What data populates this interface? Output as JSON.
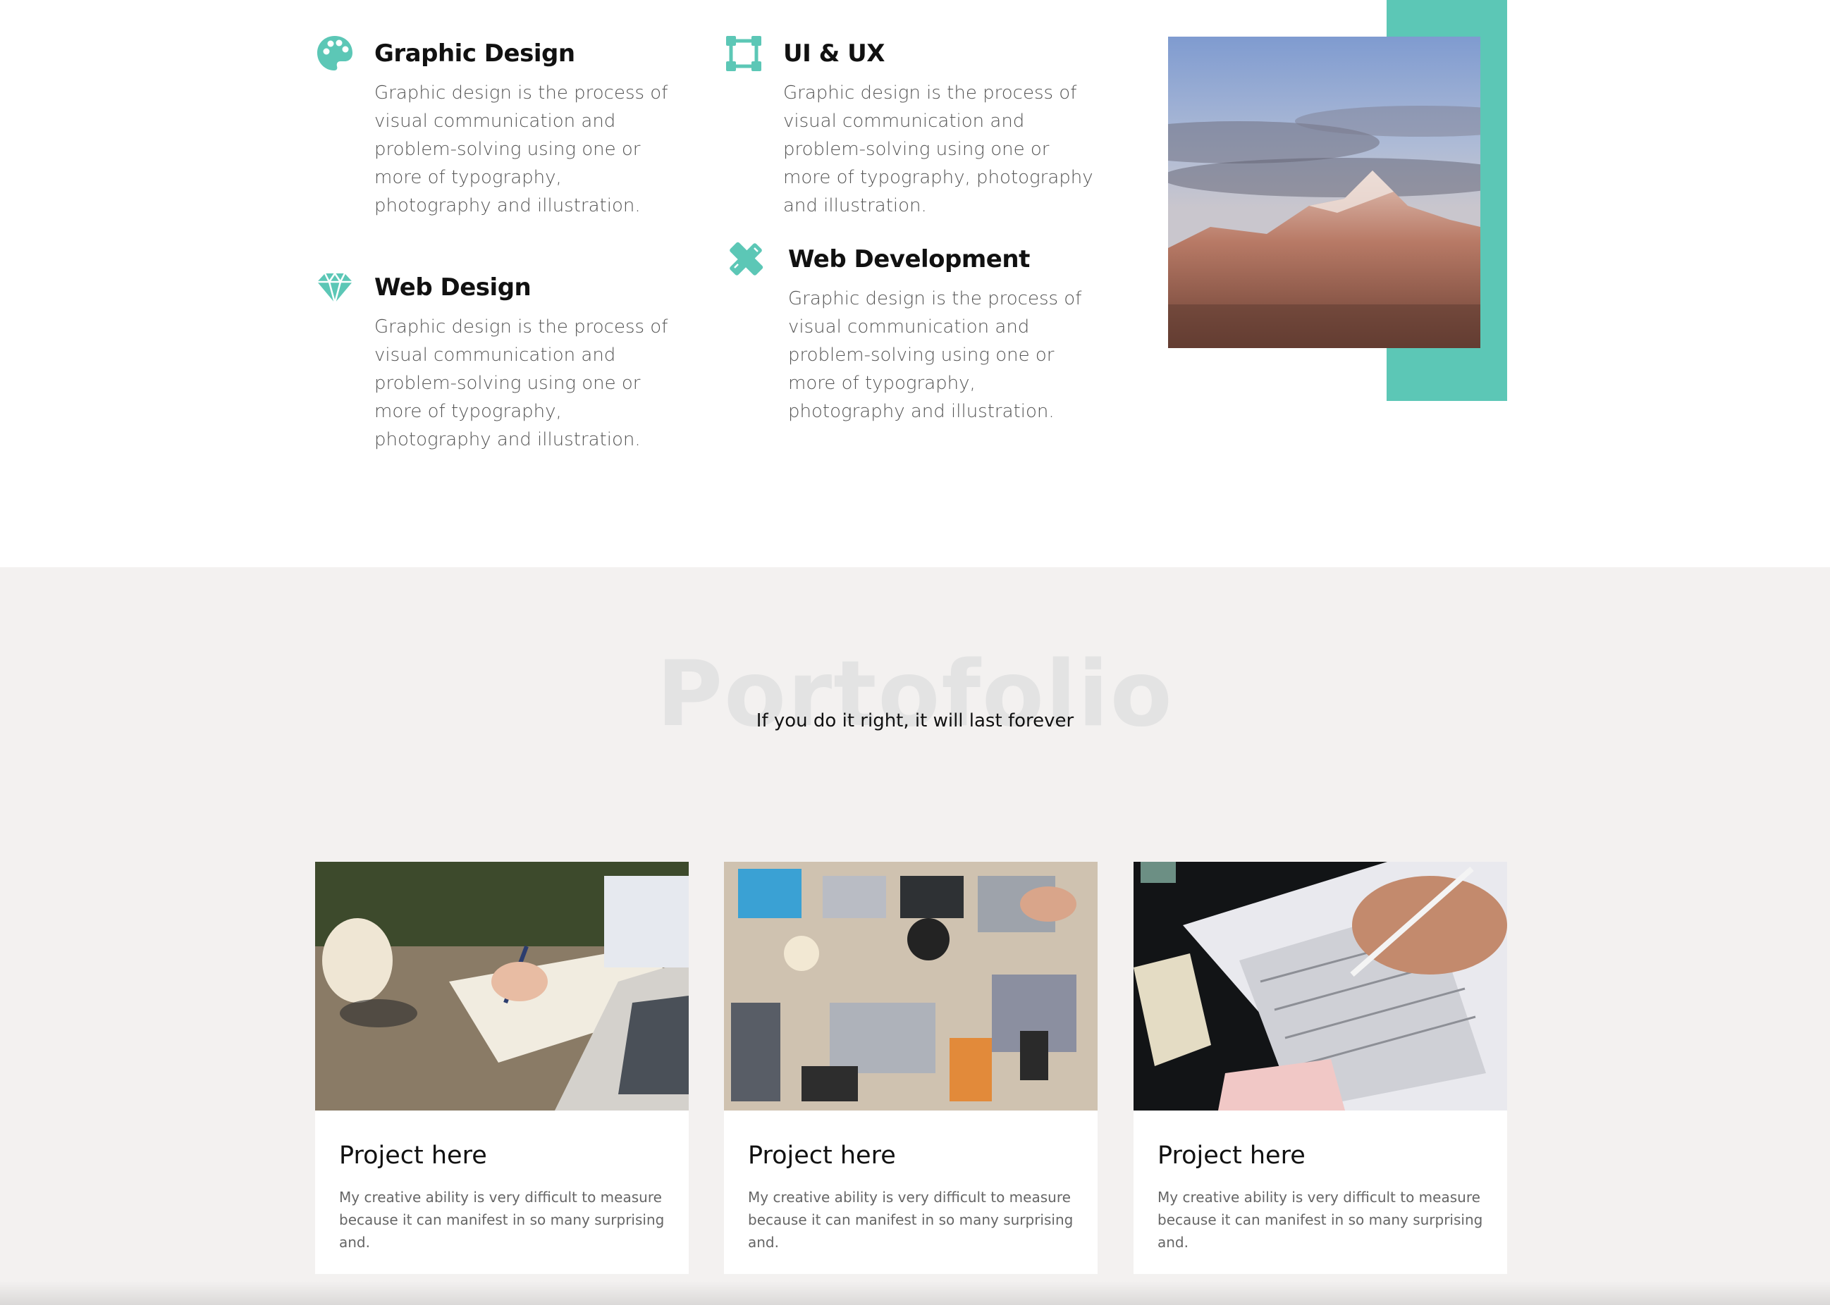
{
  "services": {
    "accent_color": "#5cc7b6",
    "items": [
      {
        "icon": "palette-icon",
        "title": "Graphic Design",
        "description": "Graphic design is the process of visual communication and problem-solving using one or more of typography, photography and illustration."
      },
      {
        "icon": "vector-square-icon",
        "title": "UI & UX",
        "description": "Graphic design is the process of visual communication and problem-solving using one or more of typography, photography and illustration."
      },
      {
        "icon": "diamond-icon",
        "title": "Web Design",
        "description": "Graphic design is the process of visual communication and problem-solving using one or more of typography, photography and illustration."
      },
      {
        "icon": "pencil-ruler-icon",
        "title": "Web Development",
        "description": "Graphic design is the process of visual communication and problem-solving using one or more of typography, photography and illustration."
      }
    ]
  },
  "portfolio": {
    "heading": "Portofolio",
    "tagline": "If you do it right, it will last forever",
    "background": "#f3f1f0",
    "projects": [
      {
        "title": "Project here",
        "description": "My creative ability is very difficult to measure because it can manifest in so many surprising and."
      },
      {
        "title": "Project here",
        "description": "My creative ability is very difficult to measure because it can manifest in so many surprising and."
      },
      {
        "title": "Project here",
        "description": "My creative ability is very difficult to measure because it can manifest in so many surprising and."
      }
    ]
  }
}
